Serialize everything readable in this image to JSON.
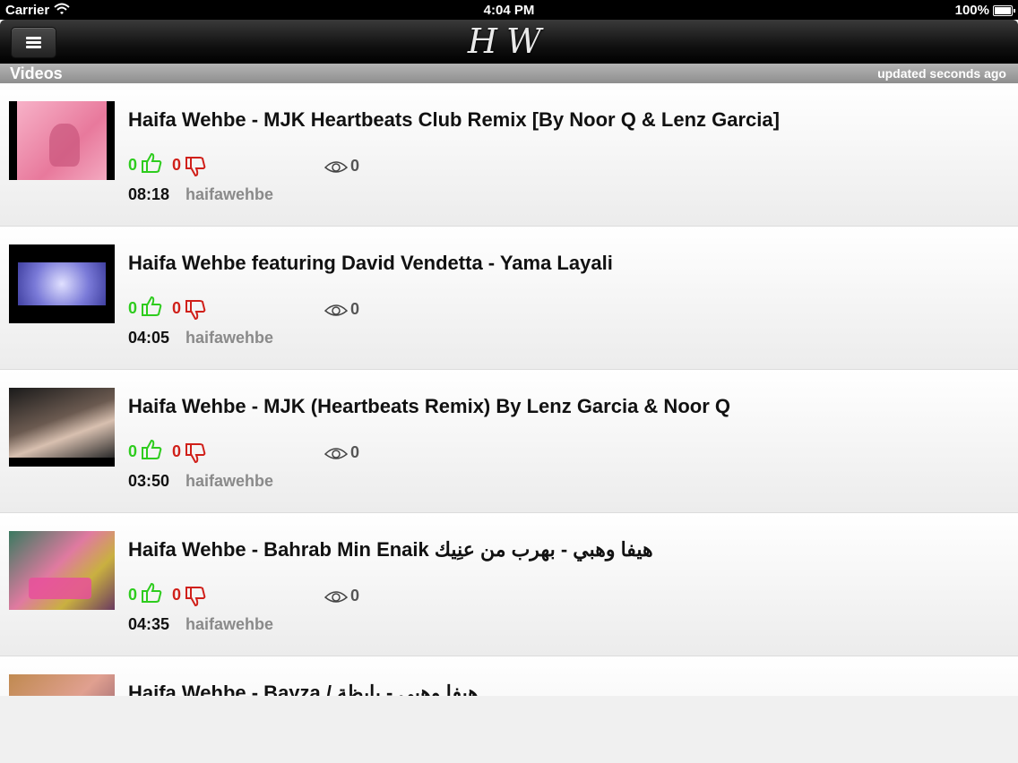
{
  "status_bar": {
    "carrier": "Carrier",
    "time": "4:04 PM",
    "battery": "100%"
  },
  "nav": {
    "logo": "HW"
  },
  "header": {
    "title": "Videos",
    "updated": "updated seconds ago"
  },
  "colors": {
    "like": "#2ecc1e",
    "dislike": "#d0201a",
    "nav_bg": "#111111",
    "header_bg": "#9e9e9e"
  },
  "videos": [
    {
      "title": "Haifa Wehbe - MJK Heartbeats Club Remix [By Noor Q & Lenz Garcia]",
      "likes": "0",
      "dislikes": "0",
      "views": "0",
      "duration": "08:18",
      "channel": "haifawehbe"
    },
    {
      "title": "Haifa Wehbe featuring David Vendetta - Yama Layali",
      "likes": "0",
      "dislikes": "0",
      "views": "0",
      "duration": "04:05",
      "channel": "haifawehbe"
    },
    {
      "title": "Haifa Wehbe - MJK (Heartbeats Remix) By Lenz Garcia & Noor Q",
      "likes": "0",
      "dislikes": "0",
      "views": "0",
      "duration": "03:50",
      "channel": "haifawehbe"
    },
    {
      "title": "Haifa Wehbe - Bahrab Min Enaik هيفا وهبي - بهرب من عنِيك",
      "likes": "0",
      "dislikes": "0",
      "views": "0",
      "duration": "04:35",
      "channel": "haifawehbe"
    },
    {
      "title": "Haifa Wehbe - Bayza / هيفا وهبي - بايظة",
      "likes": "",
      "dislikes": "",
      "views": "",
      "duration": "",
      "channel": ""
    }
  ]
}
